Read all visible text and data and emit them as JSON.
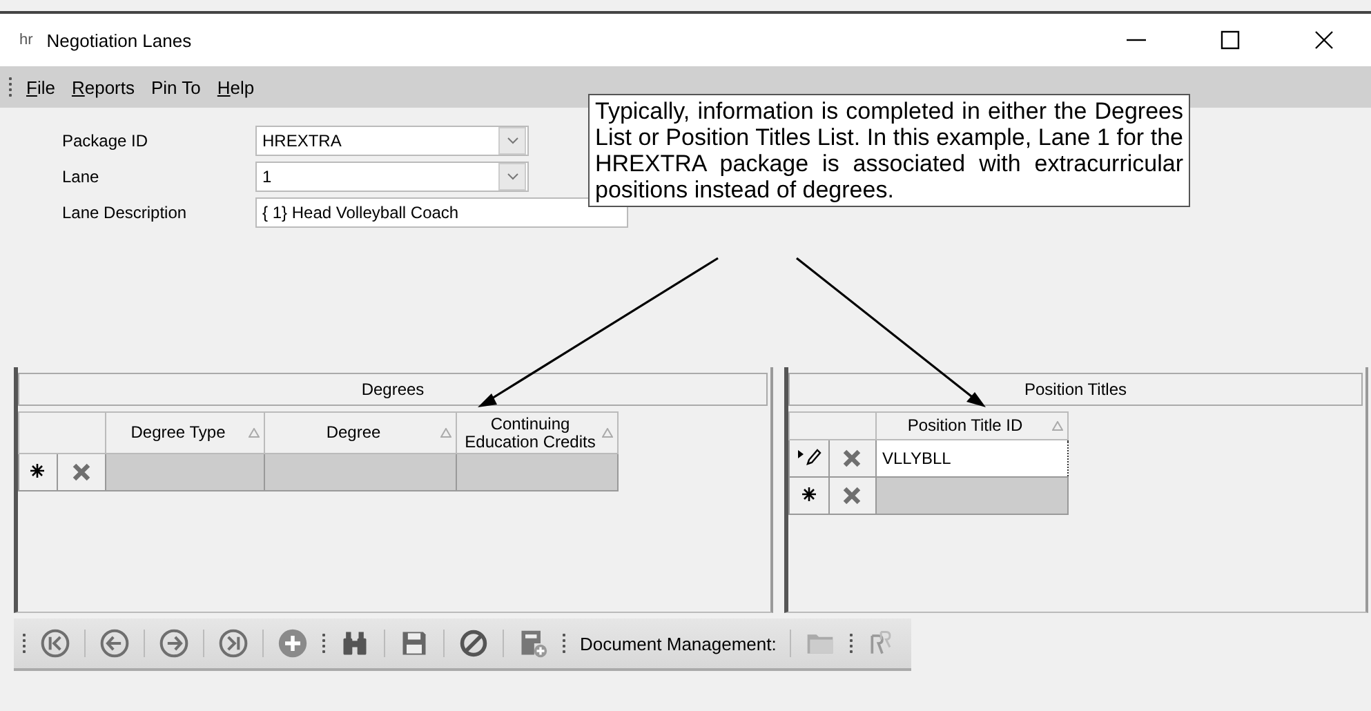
{
  "window": {
    "app_icon_text": "hr",
    "title": "Negotiation Lanes"
  },
  "menu": [
    {
      "label": "File",
      "underline_first": true
    },
    {
      "label": "Reports",
      "underline_first": true
    },
    {
      "label": "Pin To",
      "underline_first": false
    },
    {
      "label": "Help",
      "underline_first": true
    }
  ],
  "form": [
    {
      "label": "Package ID",
      "value": "HREXTRA",
      "kind": "combo"
    },
    {
      "label": "Lane",
      "value": "1",
      "kind": "combo"
    },
    {
      "label": "Lane Description",
      "value": "{ 1} Head Volleyball Coach",
      "kind": "text"
    }
  ],
  "callout": {
    "text": "Typically, information is completed in either the Degrees List or Position Titles List.  In this example, Lane 1 for the HREXTRA package is associated with extracurricular positions instead of degrees."
  },
  "degrees": {
    "title": "Degrees",
    "columns": [
      "Degree Type",
      "Degree",
      "Continuing Education Credits"
    ],
    "rows": [
      {
        "kind": "new"
      }
    ]
  },
  "position_titles": {
    "title": "Position Titles",
    "columns": [
      "Position Title ID"
    ],
    "rows": [
      {
        "kind": "edit",
        "cells": [
          "VLLYBLL"
        ]
      },
      {
        "kind": "new"
      }
    ]
  },
  "toolbar": [
    {
      "kind": "first"
    },
    {
      "kind": "prev"
    },
    {
      "kind": "next"
    },
    {
      "kind": "last"
    },
    {
      "kind": "add"
    },
    {
      "kind": "grip"
    },
    {
      "kind": "find"
    },
    {
      "kind": "save"
    },
    {
      "kind": "cancel"
    },
    {
      "kind": "savenew"
    },
    {
      "kind": "grip"
    },
    {
      "kind": "label",
      "label": "Document Management:"
    },
    {
      "kind": "folder"
    },
    {
      "kind": "grip"
    },
    {
      "kind": "report"
    }
  ]
}
